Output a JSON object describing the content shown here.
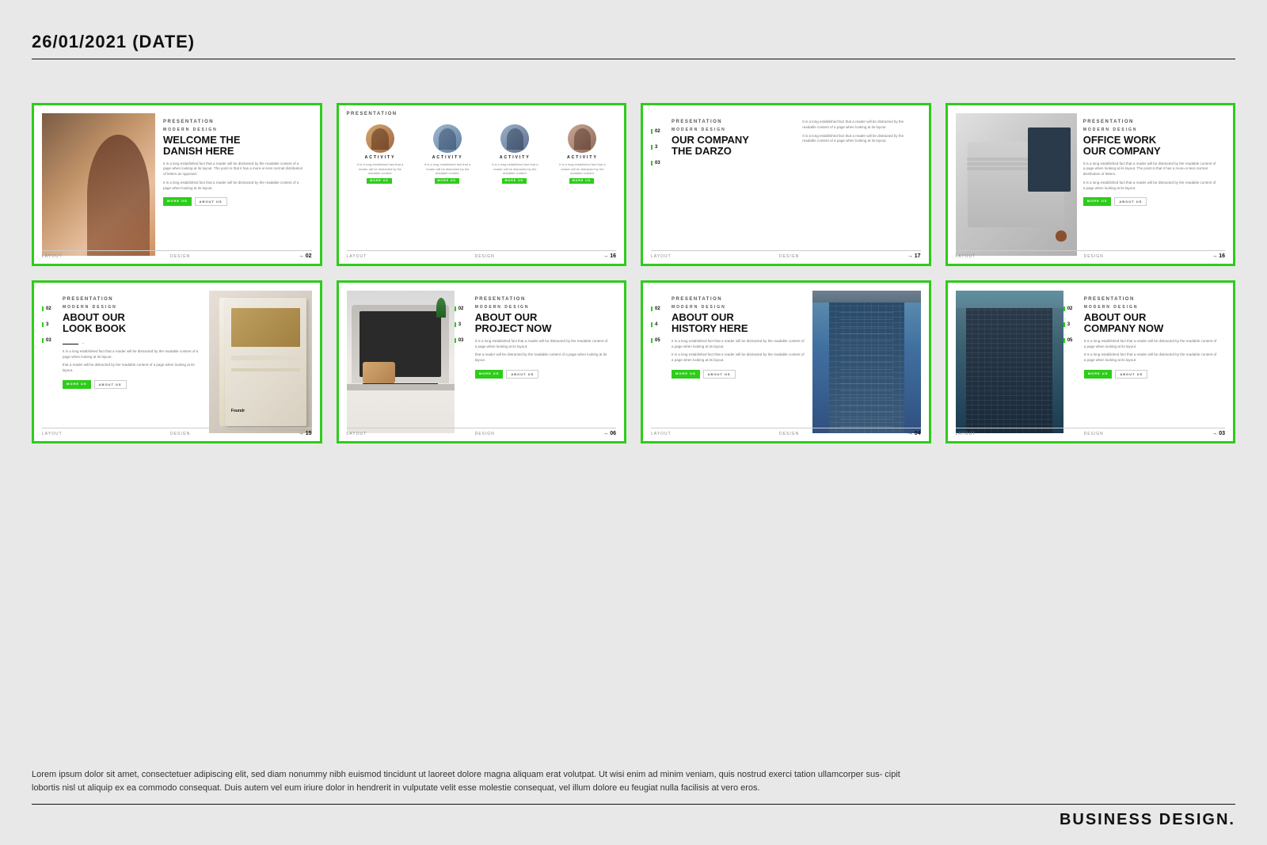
{
  "header": {
    "title": "26/01/2021 (DATE)"
  },
  "slides": [
    {
      "id": "slide-1",
      "label": "PRESENTATION",
      "subtitle": "MODERN DESIGN",
      "title": "WELCOME THE\nDANISH HERE",
      "body": "It is a long established fact that a reader will be distracted by the readable content of a page when looking at its layout. The point is that it has a more-or-less normal distribution of letters as opposed.",
      "body2": "It is a long established fact that a reader will be distracted by the readable content of a page when looking at its layout.",
      "btn1": "MORE US",
      "btn2": "ABOUT US",
      "footer_left": "LAYOUT",
      "footer_mid": "DESIGN",
      "footer_num": "→ 02"
    },
    {
      "id": "slide-2",
      "label": "PRESENTATION",
      "activities": [
        "ACTIVITY",
        "ACTIVITY",
        "ACTIVITY",
        "ACTIVITY"
      ],
      "footer_left": "LAYOUT",
      "footer_mid": "DESIGN",
      "footer_num": "→ 16"
    },
    {
      "id": "slide-3",
      "label": "PRESENTATION",
      "subtitle": "MODERN DESIGN",
      "title": "OUR COMPANY\nTHE DARZO",
      "nums": [
        "02",
        "3",
        "03"
      ],
      "body": "It is a long established fact that a reader will be distracted by the readable content of a page when looking at its layout.",
      "footer_left": "LAYOUT",
      "footer_mid": "DESIGN",
      "footer_num": "→ 17"
    },
    {
      "id": "slide-4",
      "label": "PRESENTATION",
      "subtitle": "MODERN DESIGN",
      "title": "OFFICE WORK\nOUR COMPANY",
      "body": "It is a long established fact that a reader will be distracted by the readable content of a page when looking at its layout. The point is that it has a more-or-less normal distribution of letters.",
      "body2": "It is a long established fact that a reader will be distracted by the readable content of a page when looking at its layout.",
      "btn1": "MORE US",
      "btn2": "ABOUT US",
      "footer_left": "LAYOUT",
      "footer_mid": "DESIGN",
      "footer_num": "→ 16"
    },
    {
      "id": "slide-5",
      "label": "PRESENTATION",
      "subtitle": "MODERN DESIGN",
      "title": "ABOUT OUR\nLOOK BOOK",
      "nums": [
        "02",
        "3",
        "03"
      ],
      "body": "It is a long established fact that a reader will be distracted by the readable content of a page when looking at its layout.",
      "body2": "that a reader will be distracted by the readable content of a page when looking at its layout.",
      "btn1": "MORE US",
      "btn2": "ABOUT US",
      "footer_left": "LAYOUT",
      "footer_mid": "DESIGN",
      "footer_num": "→ 15"
    },
    {
      "id": "slide-6",
      "label": "PRESENTATION",
      "subtitle": "MODERN DESIGN",
      "title": "ABOUT OUR\nPROJECT NOW",
      "nums": [
        "02",
        "3",
        "03"
      ],
      "body": "It is a long established fact that a reader will be distracted by the readable content of a page when looking at its layout.",
      "body2": "that a reader will be distracted by the readable content of a page when looking at its layout.",
      "btn1": "MORE US",
      "btn2": "ABOUT US",
      "footer_left": "LAYOUT",
      "footer_mid": "DESIGN",
      "footer_num": "→ 06"
    },
    {
      "id": "slide-7",
      "label": "PRESENTATION",
      "subtitle": "MODERN DESIGN",
      "title": "ABOUT OUR\nHISTORY HERE",
      "nums": [
        "02",
        "4",
        "05"
      ],
      "body": "It is a long established fact that a reader will be distracted by the readable content of a page when looking at its layout.",
      "body2": "It is a long established fact that a reader will be distracted by the readable content of a page when looking at its layout.",
      "btn1": "MORE US",
      "btn2": "ABOUT US",
      "footer_left": "LAYOUT",
      "footer_mid": "DESIGN",
      "footer_num": "→ 04"
    },
    {
      "id": "slide-8",
      "label": "PRESENTATION",
      "subtitle": "MODERN DESIGN",
      "title": "ABOUT OUR\nCOMPANY NOW",
      "nums": [
        "02",
        "3",
        "05"
      ],
      "body": "It is a long established fact that a reader will be distracted by the readable content of a page when looking at its layout.",
      "body2": "It is a long established fact that a reader will be distracted by the readable content of a page when looking at its layout.",
      "btn1": "MORE US",
      "btn2": "ABOUT US",
      "footer_left": "LAYOUT",
      "footer_mid": "DESIGN",
      "footer_num": "→ 03"
    }
  ],
  "footer": {
    "text": "Lorem ipsum dolor sit amet, consectetuer adipiscing elit, sed diam nonummy nibh euismod tincidunt ut laoreet dolore magna aliquam erat volutpat. Ut wisi enim ad minim veniam, quis nostrud exerci tation ullamcorper sus-\ncipit lobortis nisl ut aliquip ex ea commodo consequat. Duis autem vel eum iriure dolor in hendrerit in vulputate velit esse molestie consequat, vel illum dolore eu feugiat nulla facilisis at vero eros.",
    "brand": "BUSINESS DESIGN."
  }
}
